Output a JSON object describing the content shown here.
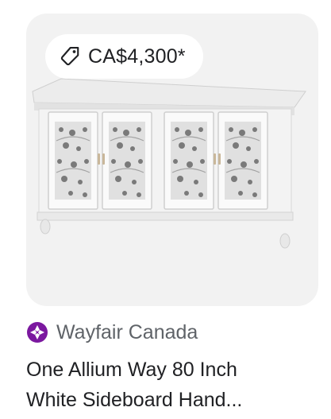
{
  "product": {
    "price": "CA$4,300*",
    "store_name": "Wayfair Canada",
    "title_line_1": "One Allium Way 80 Inch",
    "title_line_2": "White Sideboard Hand..."
  },
  "icons": {
    "price_tag": "tag-icon",
    "store": "wayfair-logo-icon"
  },
  "colors": {
    "store_logo": "#7b189f",
    "tile_background": "#f2f2f2",
    "secondary_text": "#5f6368"
  }
}
